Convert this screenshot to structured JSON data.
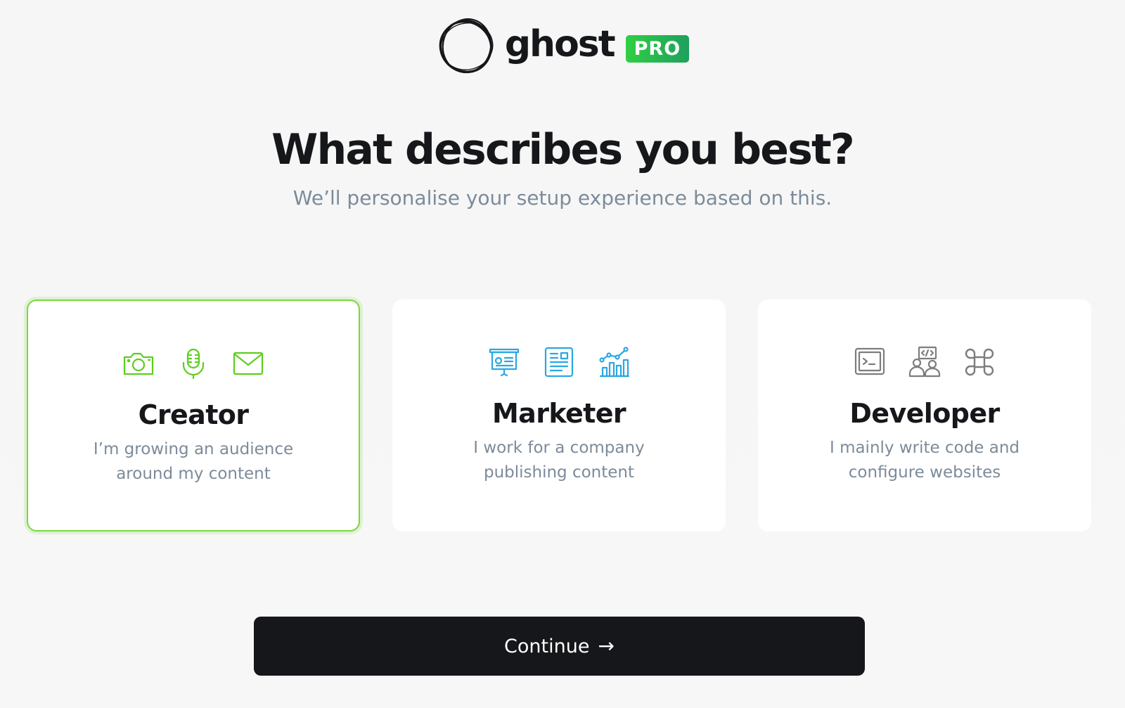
{
  "brand": {
    "wordmark": "ghost",
    "badge": "PRO"
  },
  "heading": {
    "title": "What describes you best?",
    "subtitle": "We’ll personalise your setup experience based on this."
  },
  "cards": [
    {
      "title": "Creator",
      "description": "I’m growing an audience around my content",
      "selected": true,
      "accent": "#5ccf1d",
      "icons": [
        "camera-icon",
        "microphone-icon",
        "envelope-icon"
      ]
    },
    {
      "title": "Marketer",
      "description": "I work for a company publishing content",
      "selected": false,
      "accent": "#2ba7e0",
      "icons": [
        "presentation-board-icon",
        "newsletter-icon",
        "growth-chart-icon"
      ]
    },
    {
      "title": "Developer",
      "description": "I mainly write code and configure websites",
      "selected": false,
      "accent": "#7d7d7d",
      "icons": [
        "terminal-icon",
        "team-code-icon",
        "command-key-icon"
      ]
    }
  ],
  "actions": {
    "continue_label": "Continue",
    "continue_arrow": "→"
  },
  "colors": {
    "selected_border": "#7ad83b",
    "button_bg": "#15171a",
    "muted_text": "#7c8b9a",
    "badge_green": "#30cf43"
  }
}
